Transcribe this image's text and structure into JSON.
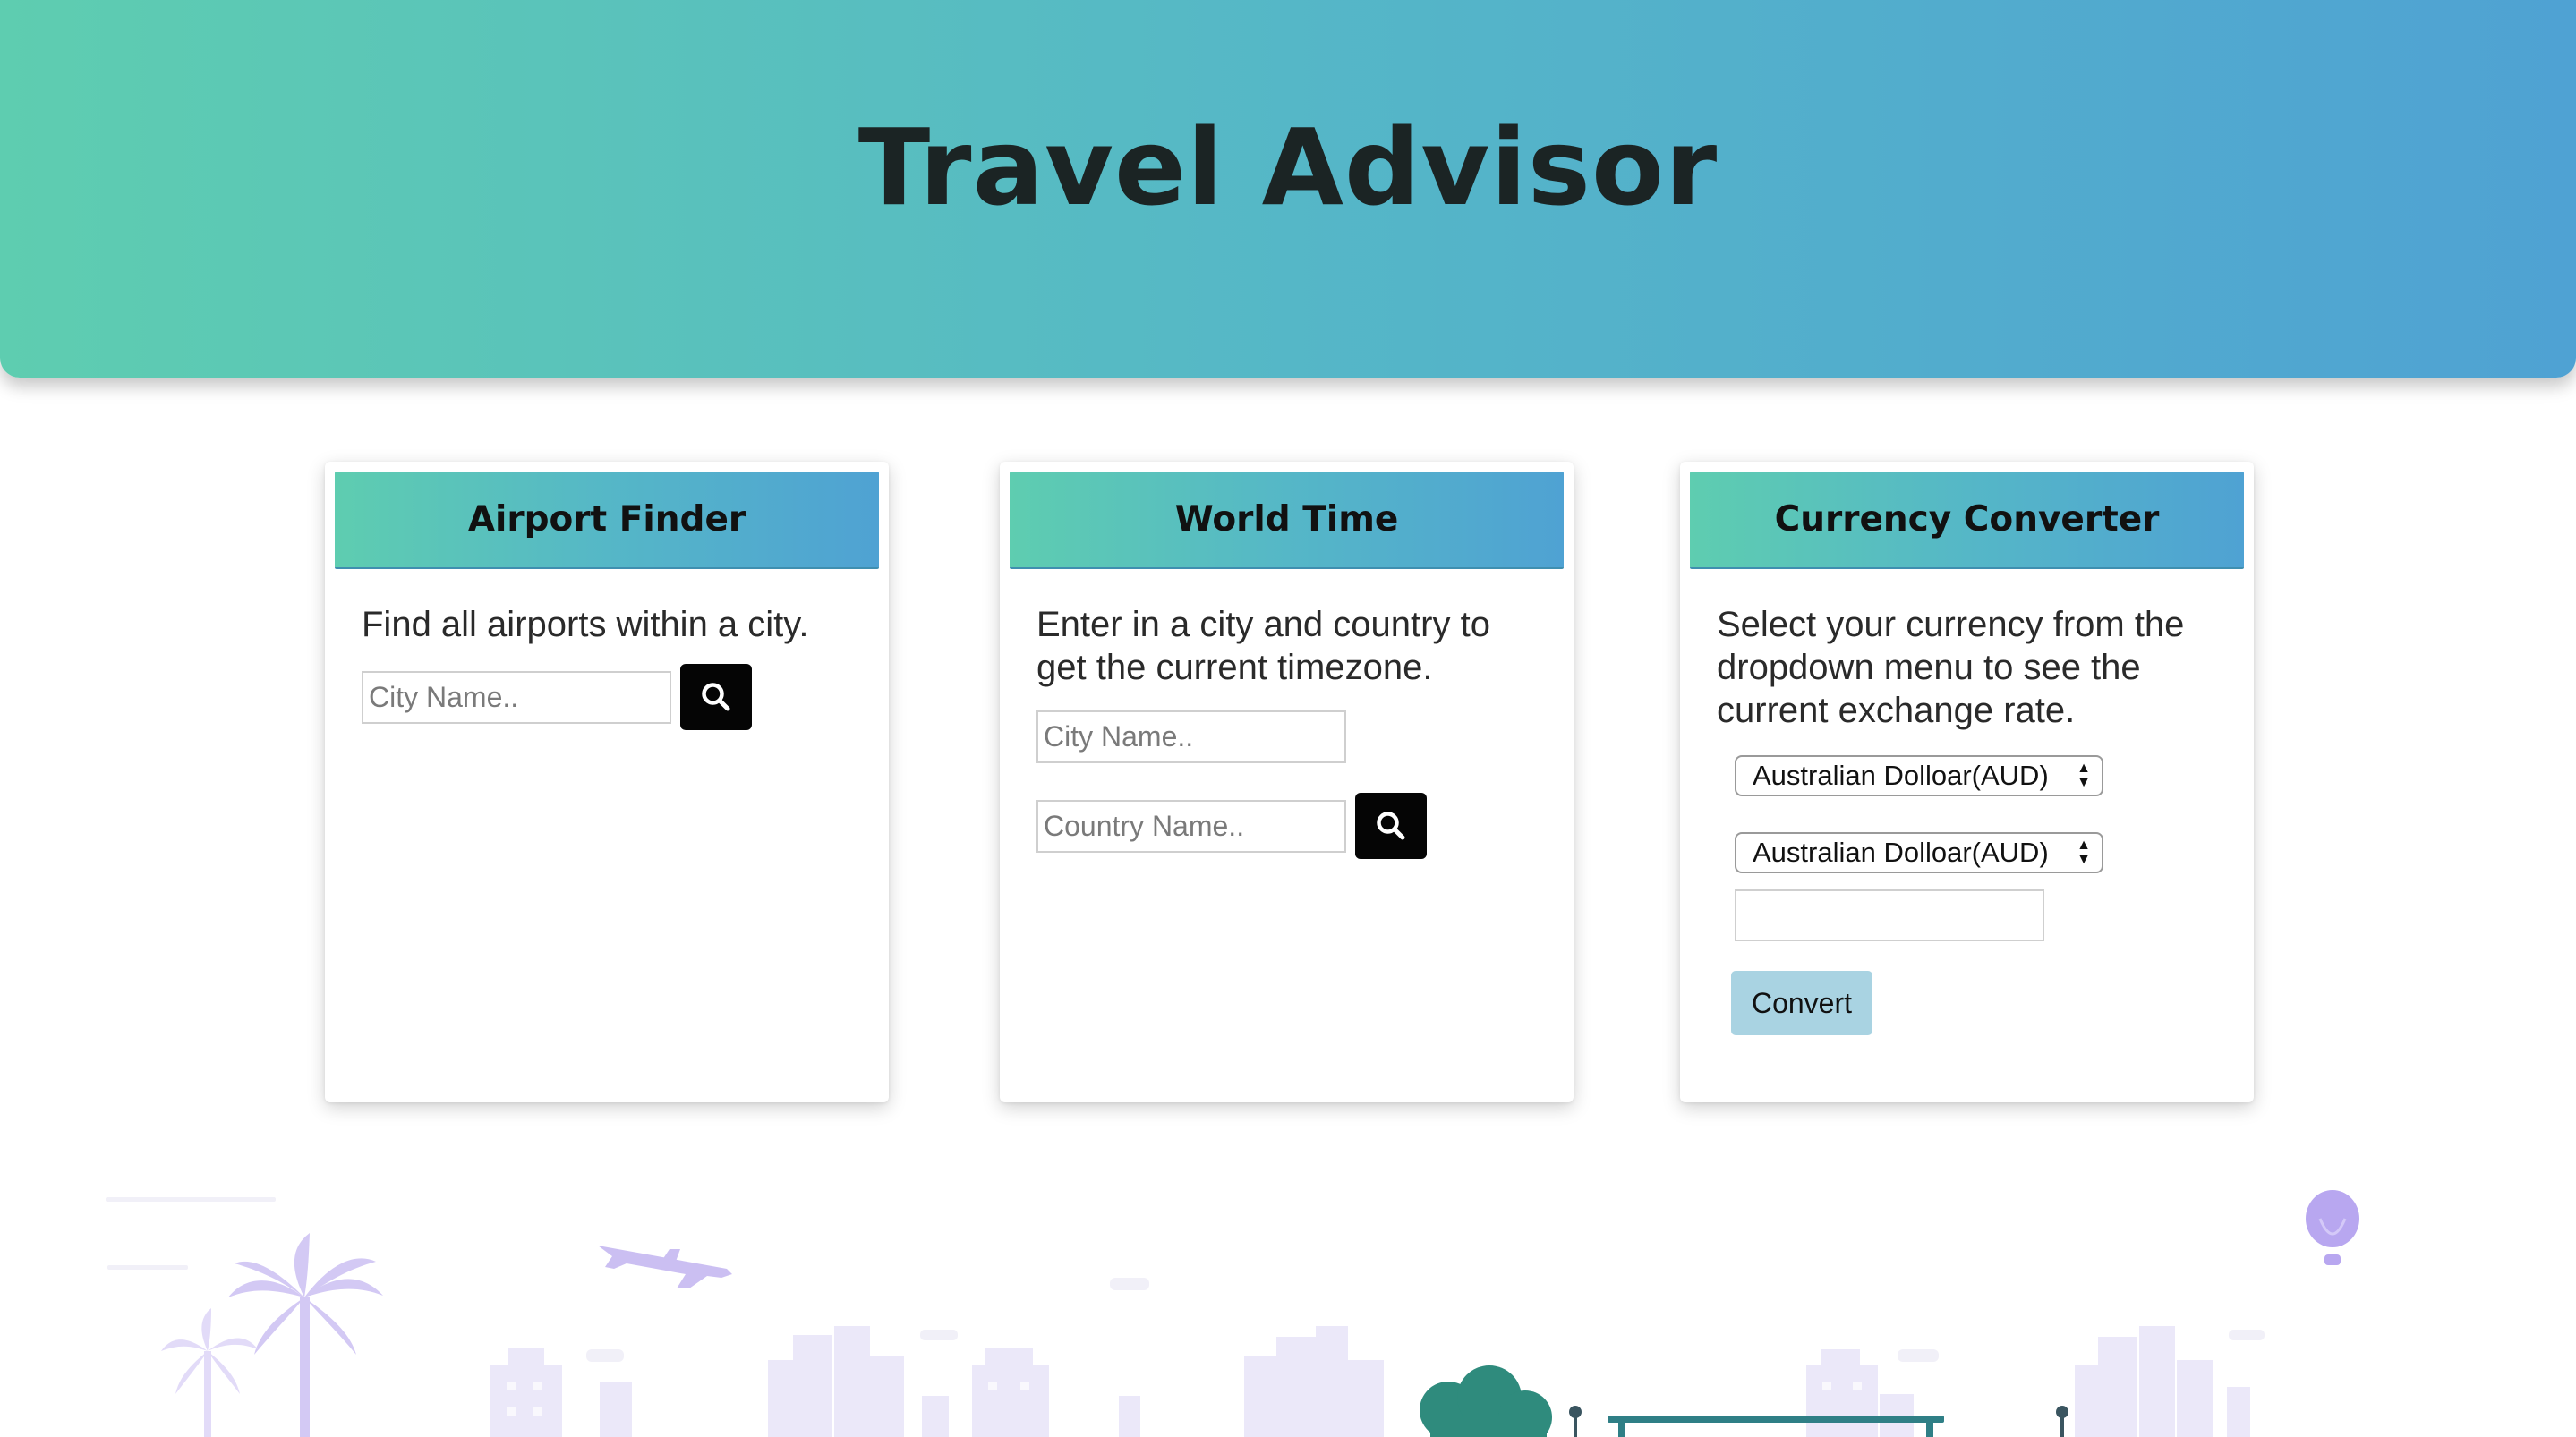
{
  "header": {
    "title": "Travel Advisor"
  },
  "airport_finder": {
    "title": "Airport Finder",
    "description": "Find all airports within a city.",
    "city_placeholder": "City Name..",
    "search_icon": "search-icon"
  },
  "world_time": {
    "title": "World Time",
    "description": "Enter in a city and country to get the current timezone.",
    "city_placeholder": "City Name..",
    "country_placeholder": "Country Name..",
    "search_icon": "search-icon"
  },
  "currency_converter": {
    "title": "Currency Converter",
    "description": "Select your currency from the dropdown menu to see the current exchange rate.",
    "from_currency": "Australian Dolloar(AUD)",
    "to_currency": "Australian Dolloar(AUD)",
    "amount_value": "",
    "convert_label": "Convert"
  },
  "colors": {
    "gradient_start": "#5ecdb0",
    "gradient_end": "#4fa2d3",
    "convert_button": "#a9d3e2",
    "search_button": "#050505",
    "illustration": "#e7e4f7"
  }
}
